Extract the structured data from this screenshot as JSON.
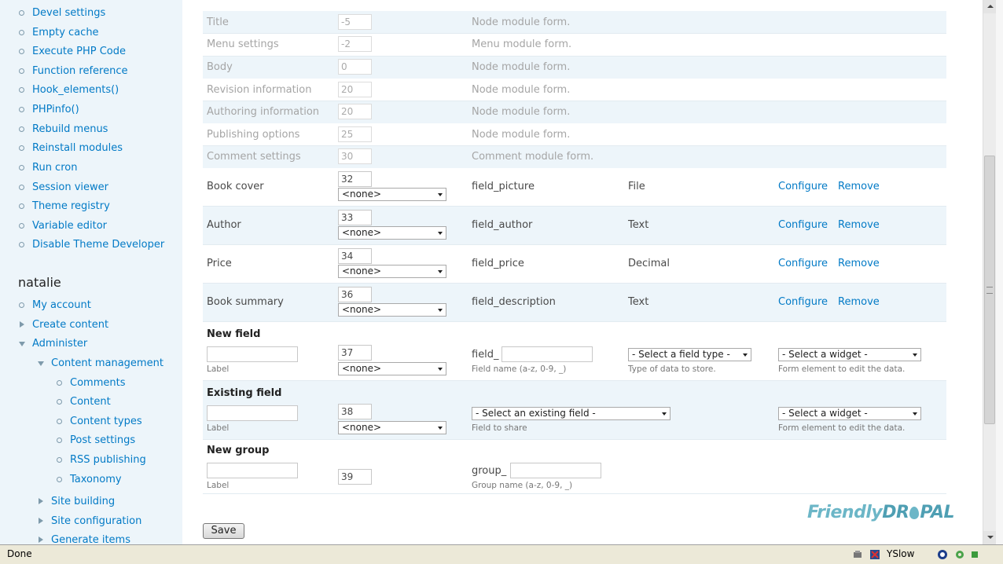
{
  "sidebar": {
    "devel_items": [
      "Devel settings",
      "Empty cache",
      "Execute PHP Code",
      "Function reference",
      "Hook_elements()",
      "PHPinfo()",
      "Rebuild menus",
      "Reinstall modules",
      "Run cron",
      "Session viewer",
      "Theme registry",
      "Variable editor",
      "Disable Theme Developer"
    ],
    "user_name": "natalie",
    "user_items": [
      "My account",
      "Create content",
      "Administer"
    ],
    "admin_items": [
      "Content management"
    ],
    "content_items": [
      "Comments",
      "Content",
      "Content types",
      "Post settings",
      "RSS publishing",
      "Taxonomy"
    ],
    "admin_more": [
      "Site building",
      "Site configuration",
      "Generate items"
    ]
  },
  "fields": {
    "core_rows": [
      {
        "label": "Title",
        "weight": "-5",
        "desc": "Node module form."
      },
      {
        "label": "Menu settings",
        "weight": "-2",
        "desc": "Menu module form."
      },
      {
        "label": "Body",
        "weight": "0",
        "desc": "Node module form."
      },
      {
        "label": "Revision information",
        "weight": "20",
        "desc": "Node module form."
      },
      {
        "label": "Authoring information",
        "weight": "20",
        "desc": "Node module form."
      },
      {
        "label": "Publishing options",
        "weight": "25",
        "desc": "Node module form."
      },
      {
        "label": "Comment settings",
        "weight": "30",
        "desc": "Comment module form."
      }
    ],
    "cck_rows": [
      {
        "label": "Book cover",
        "weight": "32",
        "group": "<none>",
        "name": "field_picture",
        "type": "File",
        "configure": "Configure",
        "remove": "Remove"
      },
      {
        "label": "Author",
        "weight": "33",
        "group": "<none>",
        "name": "field_author",
        "type": "Text",
        "configure": "Configure",
        "remove": "Remove"
      },
      {
        "label": "Price",
        "weight": "34",
        "group": "<none>",
        "name": "field_price",
        "type": "Decimal",
        "configure": "Configure",
        "remove": "Remove"
      },
      {
        "label": "Book summary",
        "weight": "36",
        "group": "<none>",
        "name": "field_description",
        "type": "Text",
        "configure": "Configure",
        "remove": "Remove"
      }
    ],
    "new_field": {
      "title": "New field",
      "weight": "37",
      "group": "<none>",
      "label_desc": "Label",
      "prefix": "field_",
      "name_desc": "Field name (a-z, 0-9, _)",
      "type_select": "- Select a field type -",
      "type_desc": "Type of data to store.",
      "widget_select": "- Select a widget -",
      "widget_desc": "Form element to edit the data."
    },
    "existing_field": {
      "title": "Existing field",
      "weight": "38",
      "group": "<none>",
      "label_desc": "Label",
      "field_select": "- Select an existing field -",
      "field_desc": "Field to share",
      "widget_select": "- Select a widget -",
      "widget_desc": "Form element to edit the data."
    },
    "new_group": {
      "title": "New group",
      "weight": "39",
      "label_desc": "Label",
      "prefix": "group_",
      "name_desc": "Group name (a-z, 0-9, _)"
    }
  },
  "save_label": "Save",
  "logo_text_1": "Friendly",
  "logo_text_2": "DR",
  "logo_text_3": "PAL",
  "status": {
    "text": "Done",
    "yslow": "YSlow"
  }
}
